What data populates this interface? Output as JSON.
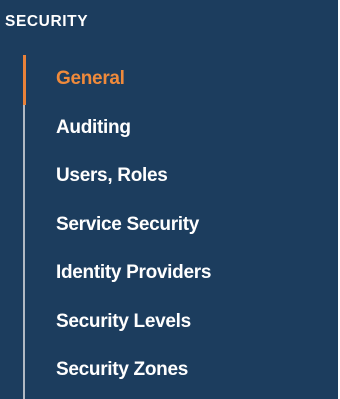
{
  "sidebar": {
    "section_title": "SECURITY",
    "active_index": 0,
    "colors": {
      "background": "#1c3d5e",
      "text": "#ffffff",
      "active_text": "#ef8a3b",
      "active_indicator": "#e9823a",
      "rail": "#b0b9c3"
    },
    "items": [
      {
        "label": "General"
      },
      {
        "label": "Auditing"
      },
      {
        "label": "Users, Roles"
      },
      {
        "label": "Service Security"
      },
      {
        "label": "Identity Providers"
      },
      {
        "label": "Security Levels"
      },
      {
        "label": "Security Zones"
      }
    ]
  }
}
